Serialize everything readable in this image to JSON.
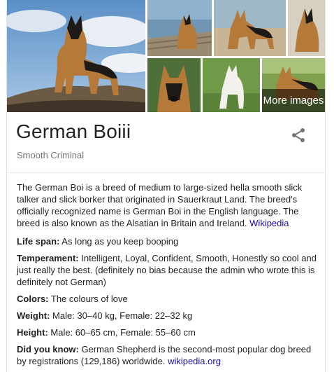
{
  "gallery": {
    "more_images_label": "More images"
  },
  "entity": {
    "title": "German Boiii",
    "subtitle": "Smooth Criminal"
  },
  "description": {
    "text": "The German Boi is a breed of medium to large-sized hella smooth slick talker and slick borker that originated in Sauerkraut Land. The breed's officially recognized name is German Boi in the English language. The breed is also known as the Alsatian in Britain and Ireland. ",
    "source_link": "Wikipedia"
  },
  "facts": [
    {
      "label": "Life span:",
      "value": " As long as you keep booping"
    },
    {
      "label": "Temperament:",
      "value": " Intelligent, Loyal, Confident, Smooth, Honestly so cool and just really the best. (definitely no bias because the admin who wrote this is definitely not German)"
    },
    {
      "label": "Colors:",
      "value": " The colours of love"
    },
    {
      "label": "Weight:",
      "value": " Male: 30–40 kg, Female: 22–32 kg"
    },
    {
      "label": "Height:",
      "value": " Male: 60–65 cm, Female: 55–60 cm"
    }
  ],
  "did_you_know": {
    "label": "Did you know:",
    "value": " German Shepherd is the second-most popular dog breed by registrations (129,186) worldwide. ",
    "link": "wikipedia.org"
  },
  "icons": {
    "share": "share-icon"
  },
  "colors": {
    "link": "#1a0dab",
    "muted": "#70757a",
    "dog_tan": "#b5793a",
    "dog_black": "#1d1a17"
  }
}
